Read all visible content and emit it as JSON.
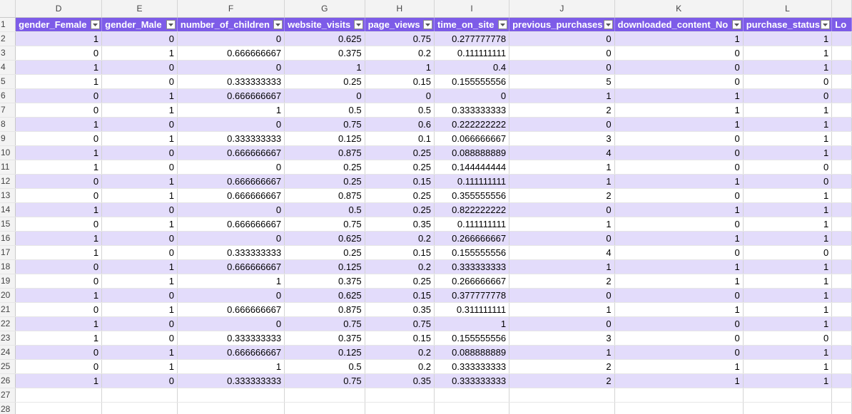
{
  "column_letters": [
    "D",
    "E",
    "F",
    "G",
    "H",
    "I",
    "J",
    "K",
    "L"
  ],
  "header_row_number": "1",
  "headers": [
    "gender_Female",
    "gender_Male",
    "number_of_children",
    "website_visits",
    "page_views",
    "time_on_site",
    "previous_purchases",
    "downloaded_content_No",
    "purchase_status"
  ],
  "cut_off_column": {
    "letter": "",
    "header": "Lo"
  },
  "filter_icon": "dropdown-arrow-icon",
  "header_fill": "#7d5ce8",
  "band_fill": "#e3dcfb",
  "rows": [
    {
      "n": "2",
      "cells": [
        "1",
        "0",
        "0",
        "0.625",
        "0.75",
        "0.277777778",
        "0",
        "1",
        "1"
      ]
    },
    {
      "n": "3",
      "cells": [
        "0",
        "1",
        "0.666666667",
        "0.375",
        "0.2",
        "0.111111111",
        "0",
        "0",
        "1"
      ]
    },
    {
      "n": "4",
      "cells": [
        "1",
        "0",
        "0",
        "1",
        "1",
        "0.4",
        "0",
        "0",
        "1"
      ]
    },
    {
      "n": "5",
      "cells": [
        "1",
        "0",
        "0.333333333",
        "0.25",
        "0.15",
        "0.155555556",
        "5",
        "0",
        "0"
      ]
    },
    {
      "n": "6",
      "cells": [
        "0",
        "1",
        "0.666666667",
        "0",
        "0",
        "0",
        "1",
        "1",
        "0"
      ]
    },
    {
      "n": "7",
      "cells": [
        "0",
        "1",
        "1",
        "0.5",
        "0.5",
        "0.333333333",
        "2",
        "1",
        "1"
      ]
    },
    {
      "n": "8",
      "cells": [
        "1",
        "0",
        "0",
        "0.75",
        "0.6",
        "0.222222222",
        "0",
        "1",
        "1"
      ]
    },
    {
      "n": "9",
      "cells": [
        "0",
        "1",
        "0.333333333",
        "0.125",
        "0.1",
        "0.066666667",
        "3",
        "0",
        "1"
      ]
    },
    {
      "n": "10",
      "cells": [
        "1",
        "0",
        "0.666666667",
        "0.875",
        "0.25",
        "0.088888889",
        "4",
        "0",
        "1"
      ]
    },
    {
      "n": "11",
      "cells": [
        "1",
        "0",
        "0",
        "0.25",
        "0.25",
        "0.144444444",
        "1",
        "0",
        "0"
      ]
    },
    {
      "n": "12",
      "cells": [
        "0",
        "1",
        "0.666666667",
        "0.25",
        "0.15",
        "0.111111111",
        "1",
        "1",
        "0"
      ]
    },
    {
      "n": "13",
      "cells": [
        "0",
        "1",
        "0.666666667",
        "0.875",
        "0.25",
        "0.355555556",
        "2",
        "0",
        "1"
      ]
    },
    {
      "n": "14",
      "cells": [
        "1",
        "0",
        "0",
        "0.5",
        "0.25",
        "0.822222222",
        "0",
        "1",
        "1"
      ]
    },
    {
      "n": "15",
      "cells": [
        "0",
        "1",
        "0.666666667",
        "0.75",
        "0.35",
        "0.111111111",
        "1",
        "0",
        "1"
      ]
    },
    {
      "n": "16",
      "cells": [
        "1",
        "0",
        "0",
        "0.625",
        "0.2",
        "0.266666667",
        "0",
        "1",
        "1"
      ]
    },
    {
      "n": "17",
      "cells": [
        "1",
        "0",
        "0.333333333",
        "0.25",
        "0.15",
        "0.155555556",
        "4",
        "0",
        "0"
      ]
    },
    {
      "n": "18",
      "cells": [
        "0",
        "1",
        "0.666666667",
        "0.125",
        "0.2",
        "0.333333333",
        "1",
        "1",
        "1"
      ]
    },
    {
      "n": "19",
      "cells": [
        "0",
        "1",
        "1",
        "0.375",
        "0.25",
        "0.266666667",
        "2",
        "1",
        "1"
      ]
    },
    {
      "n": "20",
      "cells": [
        "1",
        "0",
        "0",
        "0.625",
        "0.15",
        "0.377777778",
        "0",
        "0",
        "1"
      ]
    },
    {
      "n": "21",
      "cells": [
        "0",
        "1",
        "0.666666667",
        "0.875",
        "0.35",
        "0.311111111",
        "1",
        "1",
        "1"
      ]
    },
    {
      "n": "22",
      "cells": [
        "1",
        "0",
        "0",
        "0.75",
        "0.75",
        "1",
        "0",
        "0",
        "1"
      ]
    },
    {
      "n": "23",
      "cells": [
        "1",
        "0",
        "0.333333333",
        "0.375",
        "0.15",
        "0.155555556",
        "3",
        "0",
        "0"
      ]
    },
    {
      "n": "24",
      "cells": [
        "0",
        "1",
        "0.666666667",
        "0.125",
        "0.2",
        "0.088888889",
        "1",
        "0",
        "1"
      ]
    },
    {
      "n": "25",
      "cells": [
        "0",
        "1",
        "1",
        "0.5",
        "0.2",
        "0.333333333",
        "2",
        "1",
        "1"
      ]
    },
    {
      "n": "26",
      "cells": [
        "1",
        "0",
        "0.333333333",
        "0.75",
        "0.35",
        "0.333333333",
        "2",
        "1",
        "1"
      ]
    }
  ],
  "empty_rows": [
    "27",
    "28"
  ]
}
